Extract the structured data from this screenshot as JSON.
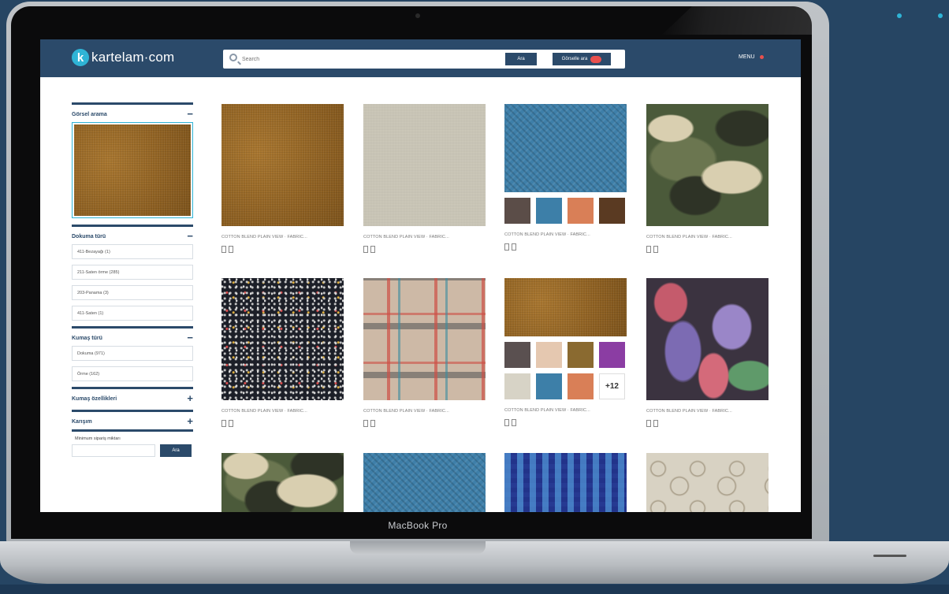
{
  "device_label": "MacBook Pro",
  "header": {
    "logo_letter": "k",
    "logo_text": "kartelam·com",
    "search_placeholder": "Search",
    "search_button": "Ara",
    "upload_button": "Görselle ara",
    "menu_label": "MENU"
  },
  "sidebar": {
    "visual_search": {
      "title": "Görsel arama",
      "control": "−"
    },
    "weave_type": {
      "title": "Dokuma türü",
      "control": "−",
      "items": [
        "411-Bezayağı (1)",
        "211-Saten örme (285)",
        "203-Panama (3)",
        "411-Saten (1)"
      ]
    },
    "fabric_type": {
      "title": "Kumaş türü",
      "control": "−",
      "items": [
        "Dokuma (971)",
        "Örme (162)"
      ]
    },
    "fabric_features": {
      "title": "Kumaş özellikleri",
      "control": "+"
    },
    "composition": {
      "title": "Karışım",
      "control": "+"
    },
    "min_order": {
      "label": "Minimum sipariş miktarı",
      "button": "Ara"
    }
  },
  "products": [
    {
      "title": "COTTON BLEND PLAIN VIEW · FABRIC...",
      "texture": "burlap"
    },
    {
      "title": "COTTON BLEND PLAIN VIEW · FABRIC...",
      "texture": "linen"
    },
    {
      "title": "COTTON BLEND PLAIN VIEW · FABRIC...",
      "texture": "blue-weave",
      "colors": [
        "#5b4d48",
        "#3d7fa8",
        "#d97f57",
        "#5a3a22"
      ]
    },
    {
      "title": "COTTON BLEND PLAIN VIEW · FABRIC...",
      "texture": "camo"
    },
    {
      "title": "COTTON BLEND PLAIN VIEW · FABRIC...",
      "texture": "speckle"
    },
    {
      "title": "COTTON BLEND PLAIN VIEW · FABRIC...",
      "texture": "plaid"
    },
    {
      "title": "COTTON BLEND PLAIN VIEW · FABRIC...",
      "texture": "burlap",
      "colors": [
        "#5a5050",
        "#e5c8b0",
        "#8a6a30",
        "#8b3da3",
        "#d7d3c6",
        "#3d7fa8",
        "#d97f57"
      ],
      "more": "+12"
    },
    {
      "title": "COTTON BLEND PLAIN VIEW · FABRIC...",
      "texture": "floral"
    },
    {
      "title": "",
      "texture": "camo"
    },
    {
      "title": "",
      "texture": "blue-weave"
    },
    {
      "title": "",
      "texture": "pixel"
    },
    {
      "title": "",
      "texture": "paisley"
    }
  ],
  "colors": {
    "brand": "#2b4a6a",
    "accent": "#2fb4d6",
    "alert": "#e8504d",
    "background": "#264563"
  }
}
